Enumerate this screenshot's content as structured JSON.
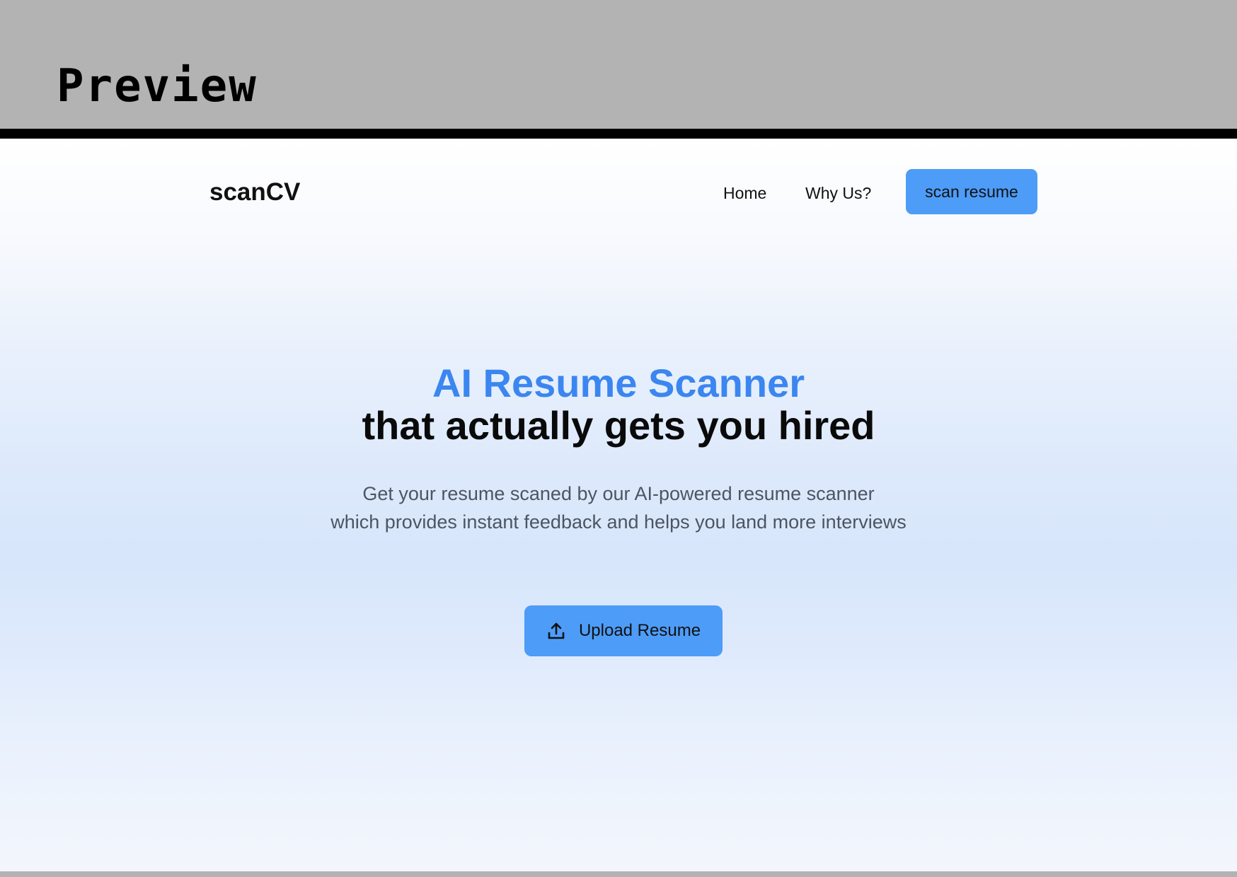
{
  "preview": {
    "title": "Preview"
  },
  "nav": {
    "brand": "scanCV",
    "links": [
      "Home",
      "Why Us?"
    ],
    "cta_label": "scan resume"
  },
  "hero": {
    "title_accent": "AI Resume Scanner",
    "title_main": "that actually gets you hired",
    "subtitle_line1": "Get your resume scaned by our AI-powered resume scanner",
    "subtitle_line2": "which provides instant feedback and helps you land more interviews",
    "upload_label": "Upload Resume",
    "upload_icon": "upload-icon"
  },
  "colors": {
    "accent": "#3b86f0",
    "button": "#4d9cf8",
    "subtitle": "#4b5563",
    "frame": "#b3b3b3"
  }
}
